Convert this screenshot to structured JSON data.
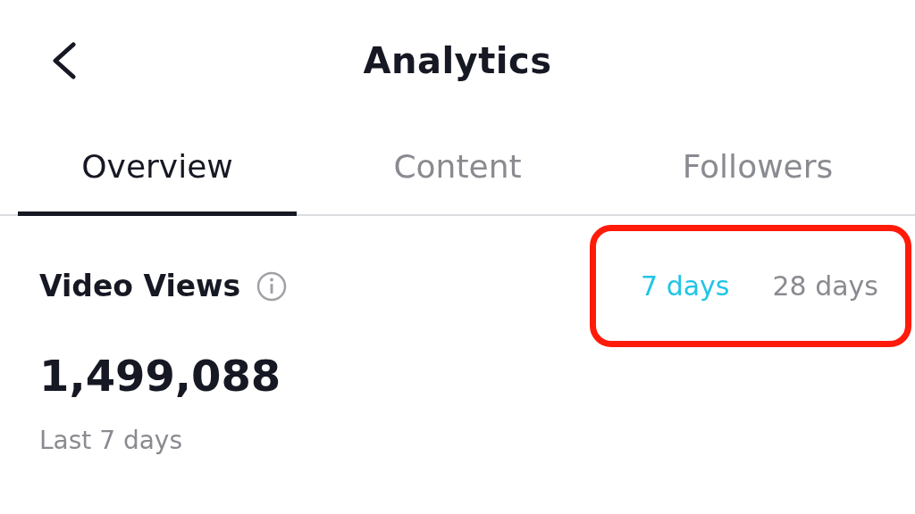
{
  "header": {
    "title": "Analytics"
  },
  "tabs": [
    {
      "label": "Overview",
      "selected": true
    },
    {
      "label": "Content",
      "selected": false
    },
    {
      "label": "Followers",
      "selected": false
    }
  ],
  "metric": {
    "title": "Video Views",
    "value": "1,499,088",
    "caption": "Last 7 days"
  },
  "period_selector": {
    "highlighted": true,
    "options": [
      {
        "label": "7 days",
        "selected": true
      },
      {
        "label": "28 days",
        "selected": false
      }
    ]
  }
}
